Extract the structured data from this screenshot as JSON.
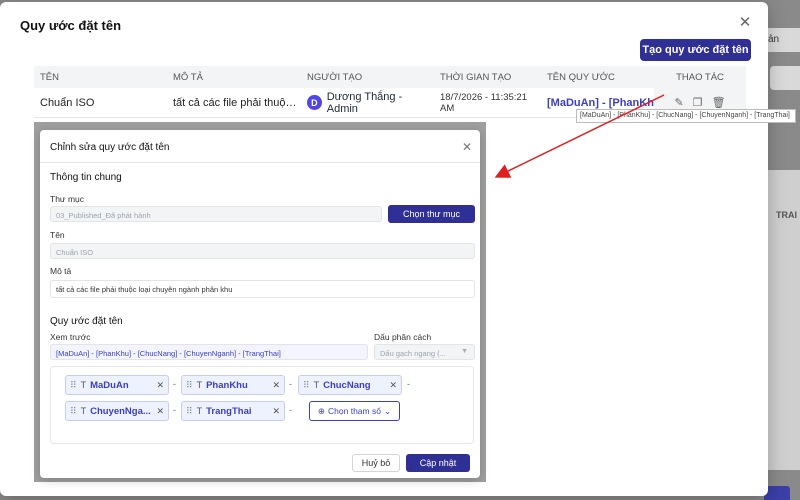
{
  "background": {
    "right_button_label": "ản",
    "right_column_label": "TRAI"
  },
  "outer_modal": {
    "title": "Quy ước đặt tên",
    "create_button": "Tạo quy ước đặt tên",
    "columns": [
      "TÊN",
      "MÔ TẢ",
      "NGƯỜI TẠO",
      "THỜI GIAN TẠO",
      "TÊN QUY ƯỚC",
      "THAO TÁC"
    ],
    "row": {
      "name": "Chuẩn ISO",
      "description": "tất cả các file phải thuộc l...",
      "creator_initial": "D",
      "creator": "Dương Thắng - Admin",
      "created_at": "18/7/2026 - 11:35:21 AM",
      "convention": "[MaDuAn] - [PhanKhu] -"
    },
    "tooltip": "[MaDuAn] - [PhanKhu] - [ChucNang] - [ChuyenNganh] - [TrangThai]"
  },
  "inner_modal": {
    "title": "Chỉnh sửa quy ước đặt tên",
    "general_section": "Thông tin chung",
    "folder_label": "Thư mục",
    "folder_value": "03_Published_Đã phát hành",
    "choose_folder_button": "Chọn thư mục",
    "name_label": "Tên",
    "name_value": "Chuẩn ISO",
    "desc_label": "Mô tả",
    "desc_value": "tất cả các file phải thuộc loại chuyên ngành phân khu",
    "convention_section": "Quy ước đặt tên",
    "preview_label": "Xem trước",
    "preview_value": "[MaDuAn] - [PhanKhu] - [ChucNang] - [ChuyenNganh] - [TrangThai]",
    "separator_label": "Dấu phân cách",
    "separator_value": "Dấu gạch ngang (...",
    "tokens": [
      "MaDuAn",
      "PhanKhu",
      "ChucNang",
      "ChuyenNga...",
      "TrangThai"
    ],
    "separator_char": "-",
    "add_param_button": "Chọn tham số",
    "cancel_button": "Huỷ bỏ",
    "update_button": "Cập nhật"
  },
  "colors": {
    "primary": "#2f2f95",
    "link": "#3b3fbf",
    "arrow": "#e02020"
  }
}
